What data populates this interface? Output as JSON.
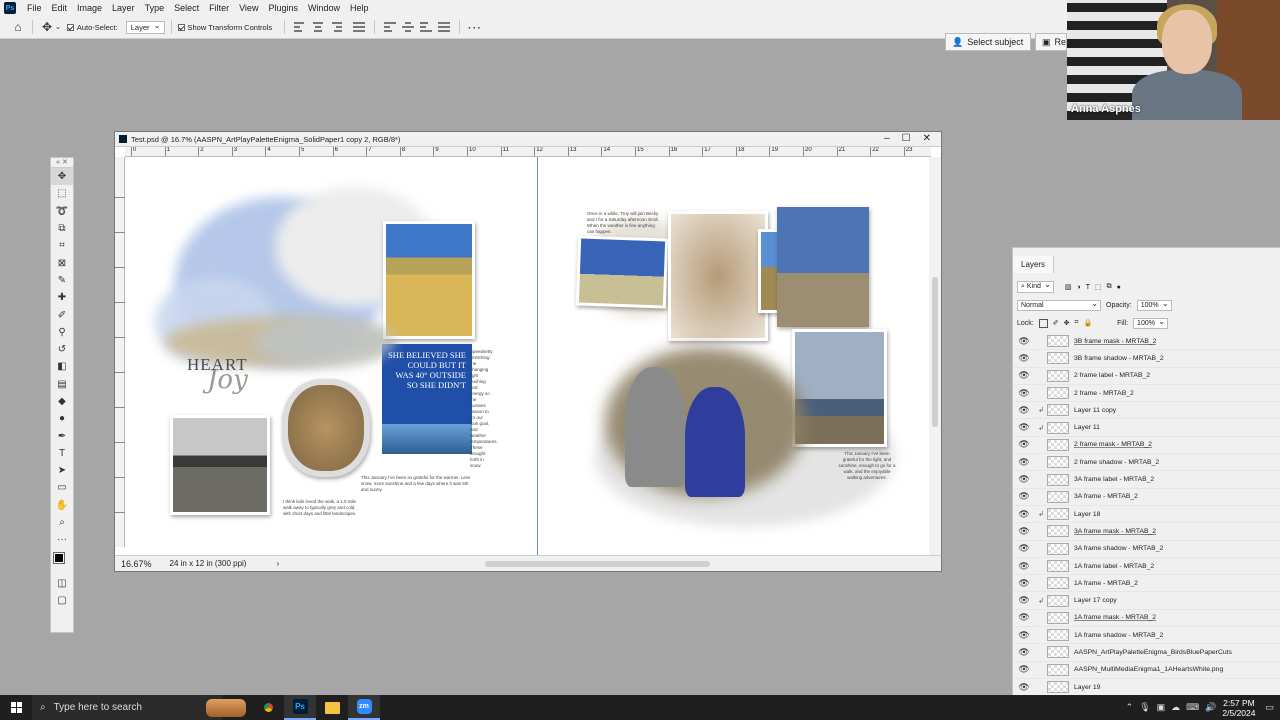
{
  "menubar": {
    "items": [
      "File",
      "Edit",
      "Image",
      "Layer",
      "Type",
      "Select",
      "Filter",
      "View",
      "Plugins",
      "Window",
      "Help"
    ]
  },
  "options": {
    "auto_select_label": "Auto-Select:",
    "auto_select_value": "Layer",
    "transform_controls_label": "Show Transform Controls",
    "select_subject": "Select subject",
    "refine": "Re"
  },
  "zoom_call": {
    "participant_name": "Anna Aspnes"
  },
  "document": {
    "title": "Test.psd @ 16.7% (AASPN_ArtPlayPaletteEnigma_SolidPaper1 copy 2, RGB/8*)",
    "zoom": "16.67%",
    "doc_size": "24 in x 12 in (300 ppi)",
    "ruler_marks": [
      "0",
      "1",
      "2",
      "3",
      "4",
      "5",
      "6",
      "7",
      "8",
      "9",
      "10",
      "11",
      "12",
      "13",
      "14",
      "15",
      "16",
      "17",
      "18",
      "19",
      "20",
      "21",
      "22",
      "23"
    ],
    "heart_title": "HEART",
    "joy_script": "Joy",
    "quote": "SHE BELIEVED SHE COULD BUT IT WAS 40° OUTSIDE SO SHE DIDN'T",
    "journal_left": "This January I've been so grateful for the warmer. Less snow, more sunshine and a few days where it was 50! and sunny.",
    "journal_caption": "I think kids loved the walk, a 1.0 mile walk away to typically grey and cold, with short days and little landscapes.",
    "journal_side": "Speedsetty stretching the changing light pushing and energy so the Aussies reason to for our look goal, and weather temperatures. These brought forth in snow.",
    "journal_top_right": "Once in a while, Troy will join Becky and I for a Saturday afternoon stroll. When the weather is fine anything can happen.",
    "journal_bottom_right": "This January I've been grateful for the light, and sunshine, enough to go for a walk, and the enjoyable walking adventures."
  },
  "tools": [
    {
      "name": "move-tool",
      "glyph": "✥"
    },
    {
      "name": "marquee-tool",
      "glyph": "⬚"
    },
    {
      "name": "lasso-tool",
      "glyph": "➰"
    },
    {
      "name": "object-select-tool",
      "glyph": "⧉"
    },
    {
      "name": "crop-tool",
      "glyph": "⌗"
    },
    {
      "name": "frame-tool",
      "glyph": "⊠"
    },
    {
      "name": "eyedropper-tool",
      "glyph": "✎"
    },
    {
      "name": "spot-heal-tool",
      "glyph": "✚"
    },
    {
      "name": "brush-tool",
      "glyph": "✐"
    },
    {
      "name": "clone-stamp-tool",
      "glyph": "⚲"
    },
    {
      "name": "history-brush-tool",
      "glyph": "↺"
    },
    {
      "name": "eraser-tool",
      "glyph": "◧"
    },
    {
      "name": "gradient-tool",
      "glyph": "▤"
    },
    {
      "name": "blur-tool",
      "glyph": "◆"
    },
    {
      "name": "dodge-tool",
      "glyph": "●"
    },
    {
      "name": "pen-tool",
      "glyph": "✒"
    },
    {
      "name": "type-tool",
      "glyph": "T"
    },
    {
      "name": "path-select-tool",
      "glyph": "➤"
    },
    {
      "name": "shape-tool",
      "glyph": "▭"
    },
    {
      "name": "hand-tool",
      "glyph": "✋"
    },
    {
      "name": "zoom-tool",
      "glyph": "⌕"
    },
    {
      "name": "edit-toolbar",
      "glyph": "···"
    }
  ],
  "layers_panel": {
    "tab": "Layers",
    "kind_filter": "Kind",
    "blend_mode": "Normal",
    "opacity_label": "Opacity:",
    "opacity_value": "100%",
    "lock_label": "Lock:",
    "fill_label": "Fill:",
    "fill_value": "100%",
    "layers": [
      {
        "name": "3B frame mask - MRTAB_2",
        "masked": true,
        "clipped": false
      },
      {
        "name": "3B frame shadow - MRTAB_2",
        "masked": false,
        "clipped": false
      },
      {
        "name": "2 frame label - MRTAB_2",
        "masked": false,
        "clipped": false
      },
      {
        "name": "2 frame - MRTAB_2",
        "masked": false,
        "clipped": false
      },
      {
        "name": "Layer 11 copy",
        "masked": false,
        "clipped": true
      },
      {
        "name": "Layer 11",
        "masked": false,
        "clipped": true
      },
      {
        "name": "2 frame mask - MRTAB_2",
        "masked": true,
        "clipped": false
      },
      {
        "name": "2 frame shadow - MRTAB_2",
        "masked": false,
        "clipped": false
      },
      {
        "name": "3A frame label - MRTAB_2",
        "masked": false,
        "clipped": false
      },
      {
        "name": "3A frame - MRTAB_2",
        "masked": false,
        "clipped": false
      },
      {
        "name": "Layer 18",
        "masked": false,
        "clipped": true
      },
      {
        "name": "3A frame mask - MRTAB_2",
        "masked": true,
        "clipped": false
      },
      {
        "name": "3A frame shadow - MRTAB_2",
        "masked": false,
        "clipped": false
      },
      {
        "name": "1A frame label - MRTAB_2",
        "masked": false,
        "clipped": false
      },
      {
        "name": "1A frame - MRTAB_2",
        "masked": false,
        "clipped": false
      },
      {
        "name": "Layer 17 copy",
        "masked": false,
        "clipped": true
      },
      {
        "name": "1A frame mask - MRTAB_2",
        "masked": true,
        "clipped": false
      },
      {
        "name": "1A frame shadow - MRTAB_2",
        "masked": false,
        "clipped": false
      },
      {
        "name": "AASPN_ArtPlayPaletteEnigma_BirdsBluePaperCuts",
        "masked": false,
        "clipped": false
      },
      {
        "name": "AASPN_MultiMediaEnigma1_1AHeartsWhite.png",
        "masked": false,
        "clipped": false
      },
      {
        "name": "Layer 19",
        "masked": false,
        "clipped": false
      }
    ]
  },
  "taskbar": {
    "search_placeholder": "Type here to search",
    "time": "2:57 PM",
    "date": "2/5/2024"
  },
  "colors": {
    "accent": "#31a8ff",
    "guide": "#6a86d8"
  }
}
